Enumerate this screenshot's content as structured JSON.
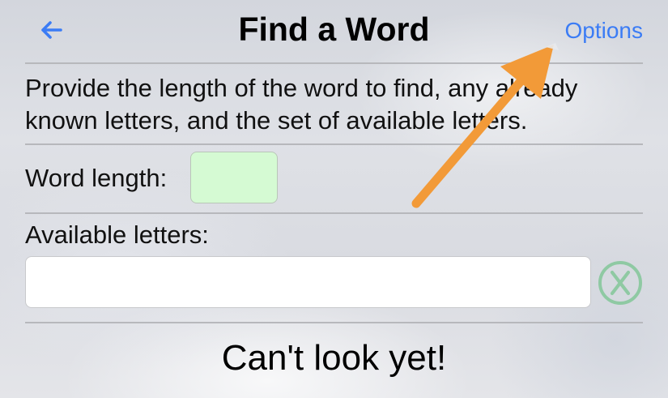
{
  "nav": {
    "title": "Find a Word",
    "options_label": "Options"
  },
  "icons": {
    "back": "arrow-left-icon",
    "clear": "circle-x-icon",
    "annotation": "orange-pointer-arrow"
  },
  "instructions": "Provide the length of the word to find, any already known letters, and the set of available letters.",
  "form": {
    "word_length_label": "Word length:",
    "word_length_value": "",
    "available_letters_label": "Available letters:",
    "available_letters_value": ""
  },
  "status": "Can't look yet!",
  "colors": {
    "accent": "#3b7cf5",
    "length_field_bg": "#d5fad3",
    "clear_icon": "#8fc9a3",
    "annotation_arrow": "#f29a38"
  }
}
